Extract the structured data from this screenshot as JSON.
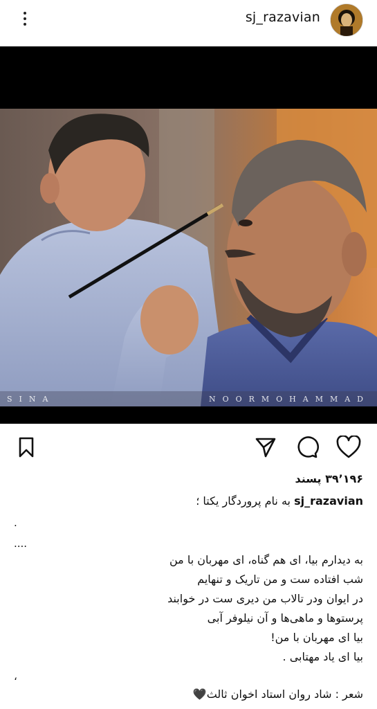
{
  "header": {
    "username": "sj_razavian",
    "more_icon": "more-vertical-icon",
    "avatar_icon": "avatar"
  },
  "post": {
    "watermark_left": "SINA",
    "watermark_right": "NOORMOHAMMAD"
  },
  "actions": {
    "save_icon": "bookmark-icon",
    "share_icon": "send-icon",
    "comment_icon": "comment-icon",
    "like_icon": "heart-icon"
  },
  "likes": {
    "count_text": "۳۹٬۱۹۶ پسند"
  },
  "caption": {
    "username": "sj_razavian",
    "first_line": "به نام پروردگار یکتا ؛",
    "mark_dot": ".",
    "mark_dots": "....",
    "lines": [
      "به دیدارم بیا، ای هم گناه، ای مهربان با من",
      "شب افتاده ست و من تاریک و تنهایم",
      "در ایوان ودر تالاب من دیری ست در خوابند",
      "پرستوها و ماهی‌ها و آن نیلوفر آبی",
      "بیا ای مهربان با من!",
      "بیا ای یاد مهتابی ."
    ],
    "mark_comma": "،",
    "poet_line": "شعر : شاد روان استاد اخوان ثالث🖤"
  },
  "colors": {
    "text": "#111111",
    "background": "#ffffff",
    "letterbox": "#000000"
  }
}
